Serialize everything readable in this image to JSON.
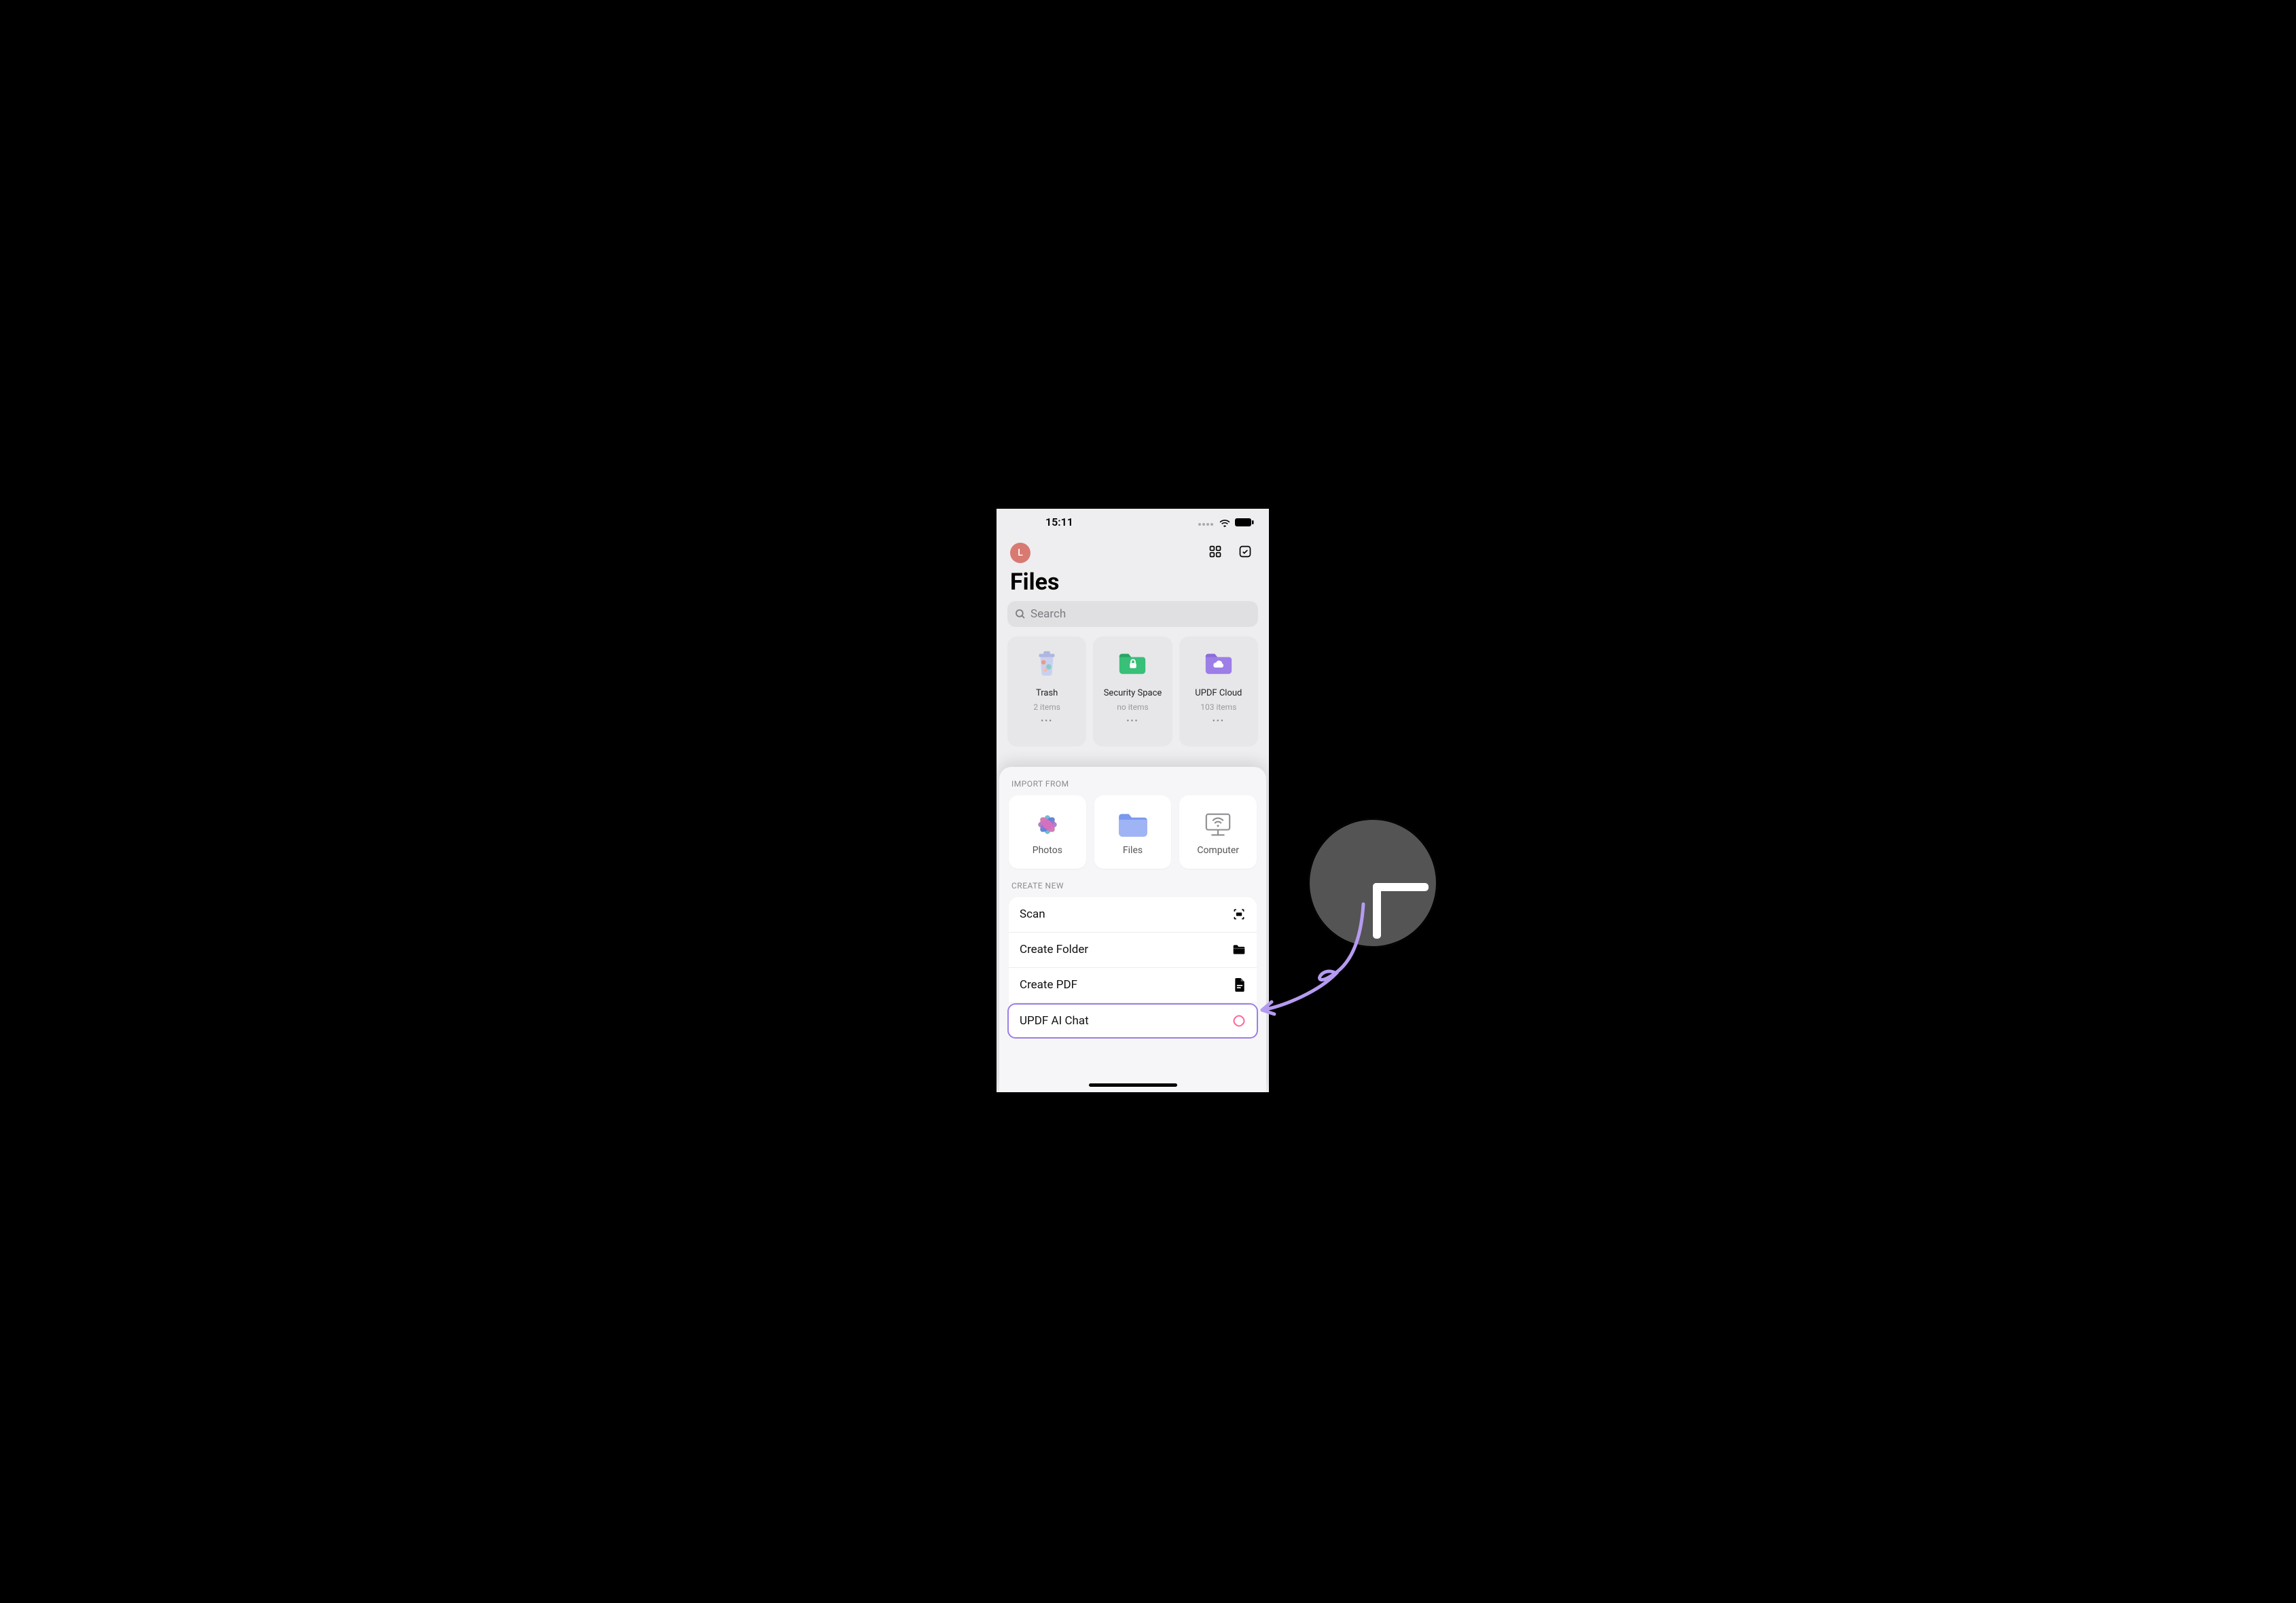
{
  "status": {
    "time": "15:11"
  },
  "header": {
    "avatarInitial": "L"
  },
  "title": "Files",
  "search": {
    "placeholder": "Search"
  },
  "folders": [
    {
      "name": "Trash",
      "sub": "2 items",
      "more": "•••",
      "iconColor": "#b7c2e8"
    },
    {
      "name": "Security Space",
      "sub": "no items",
      "more": "•••",
      "iconColor": "#3fc07a"
    },
    {
      "name": "UPDF Cloud",
      "sub": "103 items",
      "more": "•••",
      "iconColor": "#9d7ee6"
    }
  ],
  "sheet": {
    "importLabel": "IMPORT FROM",
    "imports": [
      {
        "label": "Photos"
      },
      {
        "label": "Files"
      },
      {
        "label": "Computer"
      }
    ],
    "createLabel": "CREATE NEW",
    "createItems": [
      {
        "label": "Scan"
      },
      {
        "label": "Create Folder"
      },
      {
        "label": "Create PDF"
      },
      {
        "label": "UPDF AI Chat",
        "highlight": true
      }
    ]
  },
  "colors": {
    "accent": "#9d7ee6",
    "sheetBg": "#f6f6f8",
    "phoneBg": "#eeeef0",
    "avatar": "#d87a72"
  }
}
